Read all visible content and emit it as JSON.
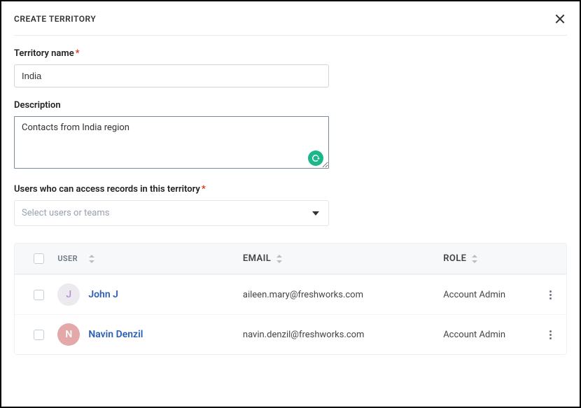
{
  "header": {
    "title": "CREATE TERRITORY"
  },
  "form": {
    "territory_name_label": "Territory name",
    "territory_name_value": "India",
    "description_label": "Description",
    "description_value": "Contacts from India region",
    "users_access_label": "Users who can access records in this territory",
    "users_select_placeholder": "Select users or teams"
  },
  "table": {
    "headers": {
      "user": "USER",
      "email": "EMAIL",
      "role": "ROLE"
    },
    "rows": [
      {
        "avatar_initial": "J",
        "name": "John J",
        "email": "aileen.mary@freshworks.com",
        "role": "Account Admin"
      },
      {
        "avatar_initial": "N",
        "name": "Navin Denzil",
        "email": "navin.denzil@freshworks.com",
        "role": "Account Admin"
      }
    ]
  }
}
